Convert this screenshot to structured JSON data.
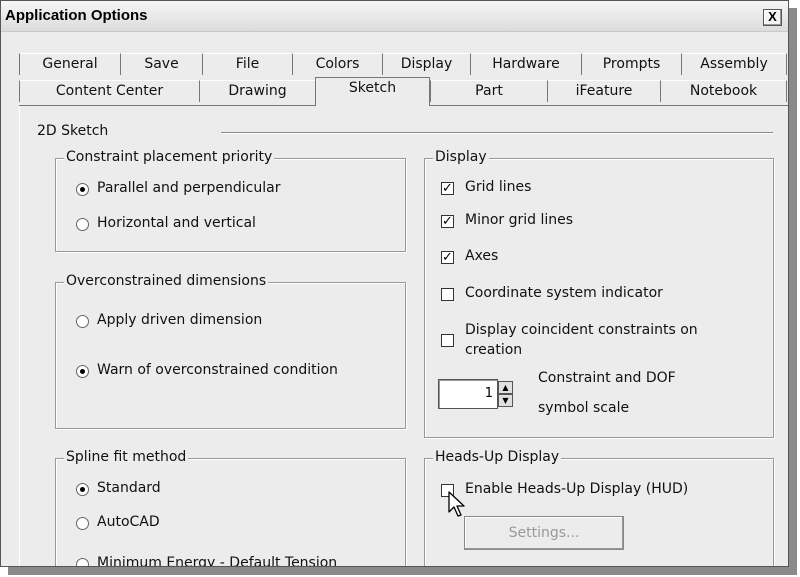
{
  "window": {
    "title": "Application Options",
    "close_label": "X"
  },
  "tabs_row1": [
    "General",
    "Save",
    "File",
    "Colors",
    "Display",
    "Hardware",
    "Prompts",
    "Assembly"
  ],
  "tabs_row2": [
    "Content Center",
    "Drawing",
    "Sketch",
    "Part",
    "iFeature",
    "Notebook"
  ],
  "active_tab": "Sketch",
  "section": {
    "title": "2D Sketch"
  },
  "constraint_group": {
    "title": "Constraint placement priority",
    "options": [
      {
        "label": "Parallel and perpendicular",
        "selected": true
      },
      {
        "label": "Horizontal and vertical",
        "selected": false
      }
    ]
  },
  "overconstrained_group": {
    "title": "Overconstrained dimensions",
    "options": [
      {
        "label": "Apply driven dimension",
        "selected": false
      },
      {
        "label": "Warn of overconstrained condition",
        "selected": true
      }
    ]
  },
  "spline_group": {
    "title": "Spline fit method",
    "options": [
      {
        "label": "Standard",
        "selected": true
      },
      {
        "label": "AutoCAD",
        "selected": false
      },
      {
        "label": "Minimum Energy - Default Tension",
        "selected": false
      }
    ]
  },
  "display_group": {
    "title": "Display",
    "checkboxes": [
      {
        "label": "Grid lines",
        "checked": true
      },
      {
        "label": "Minor grid lines",
        "checked": true
      },
      {
        "label": "Axes",
        "checked": true
      },
      {
        "label": "Coordinate system indicator",
        "checked": false
      },
      {
        "label": "Display coincident constraints on",
        "label2": "creation",
        "checked": false
      }
    ],
    "dof_value": "1",
    "dof_label1": "Constraint and DOF",
    "dof_label2": "symbol scale"
  },
  "hud_group": {
    "title": "Heads-Up Display",
    "enable_label": "Enable Heads-Up Display (HUD)",
    "enable_checked": false,
    "settings_label": "Settings..."
  }
}
